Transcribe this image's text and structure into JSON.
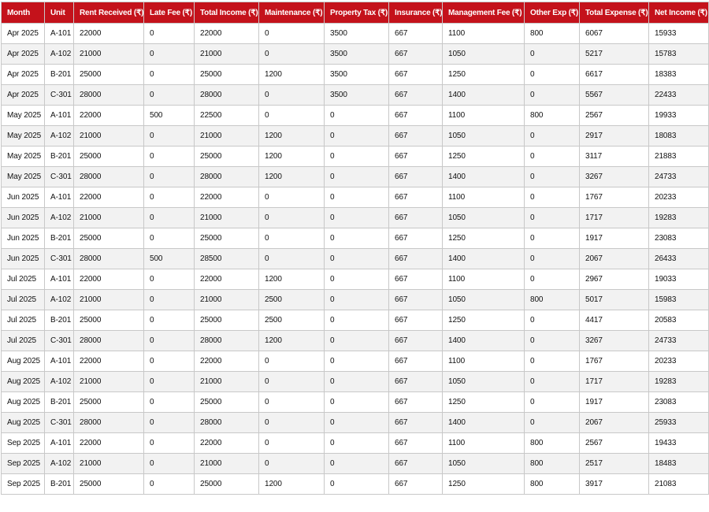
{
  "table": {
    "columns": [
      "Month",
      "Unit",
      "Rent Received (₹)",
      "Late Fee (₹)",
      "Total Income (₹)",
      "Maintenance (₹)",
      "Property Tax (₹)",
      "Insurance (₹)",
      "Management Fee (₹)",
      "Other Exp (₹)",
      "Total Expense (₹)",
      "Net Income (₹)"
    ],
    "rows": [
      [
        "Apr 2025",
        "A-101",
        "22000",
        "0",
        "22000",
        "0",
        "3500",
        "667",
        "1100",
        "800",
        "6067",
        "15933"
      ],
      [
        "Apr 2025",
        "A-102",
        "21000",
        "0",
        "21000",
        "0",
        "3500",
        "667",
        "1050",
        "0",
        "5217",
        "15783"
      ],
      [
        "Apr 2025",
        "B-201",
        "25000",
        "0",
        "25000",
        "1200",
        "3500",
        "667",
        "1250",
        "0",
        "6617",
        "18383"
      ],
      [
        "Apr 2025",
        "C-301",
        "28000",
        "0",
        "28000",
        "0",
        "3500",
        "667",
        "1400",
        "0",
        "5567",
        "22433"
      ],
      [
        "May 2025",
        "A-101",
        "22000",
        "500",
        "22500",
        "0",
        "0",
        "667",
        "1100",
        "800",
        "2567",
        "19933"
      ],
      [
        "May 2025",
        "A-102",
        "21000",
        "0",
        "21000",
        "1200",
        "0",
        "667",
        "1050",
        "0",
        "2917",
        "18083"
      ],
      [
        "May 2025",
        "B-201",
        "25000",
        "0",
        "25000",
        "1200",
        "0",
        "667",
        "1250",
        "0",
        "3117",
        "21883"
      ],
      [
        "May 2025",
        "C-301",
        "28000",
        "0",
        "28000",
        "1200",
        "0",
        "667",
        "1400",
        "0",
        "3267",
        "24733"
      ],
      [
        "Jun 2025",
        "A-101",
        "22000",
        "0",
        "22000",
        "0",
        "0",
        "667",
        "1100",
        "0",
        "1767",
        "20233"
      ],
      [
        "Jun 2025",
        "A-102",
        "21000",
        "0",
        "21000",
        "0",
        "0",
        "667",
        "1050",
        "0",
        "1717",
        "19283"
      ],
      [
        "Jun 2025",
        "B-201",
        "25000",
        "0",
        "25000",
        "0",
        "0",
        "667",
        "1250",
        "0",
        "1917",
        "23083"
      ],
      [
        "Jun 2025",
        "C-301",
        "28000",
        "500",
        "28500",
        "0",
        "0",
        "667",
        "1400",
        "0",
        "2067",
        "26433"
      ],
      [
        "Jul 2025",
        "A-101",
        "22000",
        "0",
        "22000",
        "1200",
        "0",
        "667",
        "1100",
        "0",
        "2967",
        "19033"
      ],
      [
        "Jul 2025",
        "A-102",
        "21000",
        "0",
        "21000",
        "2500",
        "0",
        "667",
        "1050",
        "800",
        "5017",
        "15983"
      ],
      [
        "Jul 2025",
        "B-201",
        "25000",
        "0",
        "25000",
        "2500",
        "0",
        "667",
        "1250",
        "0",
        "4417",
        "20583"
      ],
      [
        "Jul 2025",
        "C-301",
        "28000",
        "0",
        "28000",
        "1200",
        "0",
        "667",
        "1400",
        "0",
        "3267",
        "24733"
      ],
      [
        "Aug 2025",
        "A-101",
        "22000",
        "0",
        "22000",
        "0",
        "0",
        "667",
        "1100",
        "0",
        "1767",
        "20233"
      ],
      [
        "Aug 2025",
        "A-102",
        "21000",
        "0",
        "21000",
        "0",
        "0",
        "667",
        "1050",
        "0",
        "1717",
        "19283"
      ],
      [
        "Aug 2025",
        "B-201",
        "25000",
        "0",
        "25000",
        "0",
        "0",
        "667",
        "1250",
        "0",
        "1917",
        "23083"
      ],
      [
        "Aug 2025",
        "C-301",
        "28000",
        "0",
        "28000",
        "0",
        "0",
        "667",
        "1400",
        "0",
        "2067",
        "25933"
      ],
      [
        "Sep 2025",
        "A-101",
        "22000",
        "0",
        "22000",
        "0",
        "0",
        "667",
        "1100",
        "800",
        "2567",
        "19433"
      ],
      [
        "Sep 2025",
        "A-102",
        "21000",
        "0",
        "21000",
        "0",
        "0",
        "667",
        "1050",
        "800",
        "2517",
        "18483"
      ],
      [
        "Sep 2025",
        "B-201",
        "25000",
        "0",
        "25000",
        "1200",
        "0",
        "667",
        "1250",
        "800",
        "3917",
        "21083"
      ]
    ]
  },
  "colors": {
    "header_bg": "#c4121b",
    "header_text": "#ffffff",
    "row_alt": "#f2f2f2",
    "grid": "#c8c8c8"
  }
}
